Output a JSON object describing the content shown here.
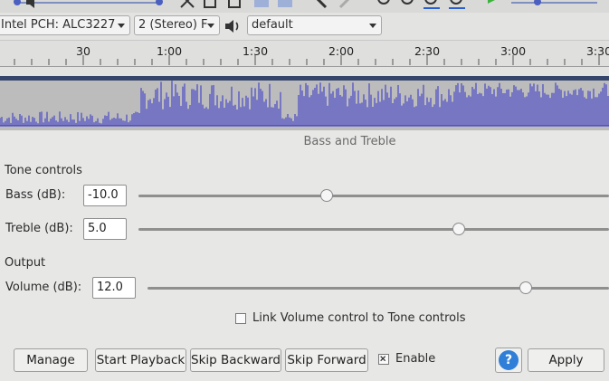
{
  "device": {
    "input_device": "Intel PCH: ALC3227",
    "channels": "2 (Stereo) F",
    "output_device": "default"
  },
  "ruler": {
    "ticks": [
      "30",
      "1:00",
      "1:30",
      "2:00",
      "2:30",
      "3:00",
      "3:30"
    ]
  },
  "dialog": {
    "title": "Bass and Treble",
    "tone_section": "Tone controls",
    "bass": {
      "label": "Bass (dB):",
      "value": "-10.0",
      "slider_fraction": 0.4
    },
    "treble": {
      "label": "Treble (dB):",
      "value": "5.0",
      "slider_fraction": 0.68
    },
    "output_section": "Output",
    "volume": {
      "label": "Volume (dB):",
      "value": "12.0",
      "slider_fraction": 0.82
    },
    "link_checkbox": {
      "label": "Link Volume control to Tone controls",
      "checked": false
    },
    "buttons": {
      "manage": "Manage",
      "start_playback": "Start Playback",
      "skip_backward": "Skip Backward",
      "skip_forward": "Skip Forward",
      "enable": "Enable",
      "help": "?",
      "apply": "Apply"
    },
    "enable_checked": true
  },
  "colors": {
    "waveform": "#3030c8",
    "track_border": "#35456b",
    "help_icon": "#2f7fd8",
    "play_green": "#3cb43c"
  }
}
